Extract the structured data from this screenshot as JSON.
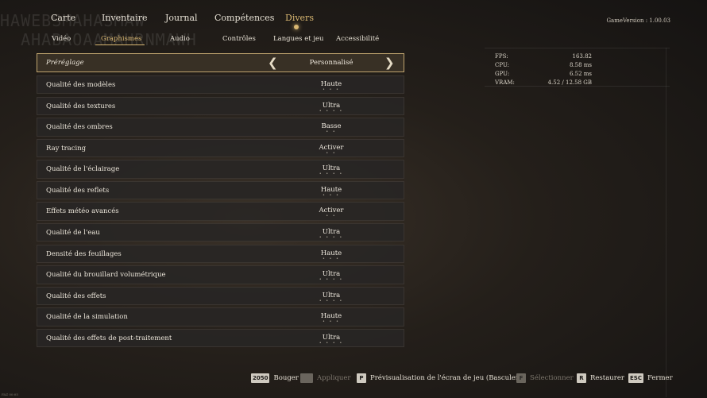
{
  "watermark": "HAWEBSMAHASMAW\n  AHABAOAAMAHRNMAWH",
  "header": {
    "main_tabs": [
      {
        "label": "Carte"
      },
      {
        "label": "Inventaire"
      },
      {
        "label": "Journal"
      },
      {
        "label": "Compétences"
      },
      {
        "label": "Divers"
      }
    ],
    "active_main_tab": "Divers",
    "sub_tabs": [
      {
        "label": "Vidéo"
      },
      {
        "label": "Graphismes"
      },
      {
        "label": "Audio"
      },
      {
        "label": "Contrôles"
      },
      {
        "label": "Langues et jeu"
      },
      {
        "label": "Accessibilité"
      }
    ],
    "active_sub_tab": "Graphismes",
    "game_version": "GameVersion : 1.00.03"
  },
  "preset": {
    "label": "Préréglage",
    "value": "Personnalisé"
  },
  "settings": [
    {
      "label": "Qualité des modèles",
      "value": "Haute",
      "dots": "• • •"
    },
    {
      "label": "Qualité des textures",
      "value": "Ultra",
      "dots": "• • • •"
    },
    {
      "label": "Qualité des ombres",
      "value": "Basse",
      "dots": "• •"
    },
    {
      "label": "Ray tracing",
      "value": "Activer",
      "dots": "• •"
    },
    {
      "label": "Qualité de l'éclairage",
      "value": "Ultra",
      "dots": "• • • •"
    },
    {
      "label": "Qualité des reflets",
      "value": "Haute",
      "dots": "• • •"
    },
    {
      "label": "Effets météo avancés",
      "value": "Activer",
      "dots": "• •"
    },
    {
      "label": "Qualité de l'eau",
      "value": "Ultra",
      "dots": "• • • •"
    },
    {
      "label": "Densité des feuillages",
      "value": "Haute",
      "dots": "• • •"
    },
    {
      "label": "Qualité du brouillard volumétrique",
      "value": "Ultra",
      "dots": "• • • •"
    },
    {
      "label": "Qualité des effets",
      "value": "Ultra",
      "dots": "• • • •"
    },
    {
      "label": "Qualité de la simulation",
      "value": "Haute",
      "dots": "• • •"
    },
    {
      "label": "Qualité des effets de post-traitement",
      "value": "Ultra",
      "dots": "• • • •"
    }
  ],
  "stats": {
    "fps": {
      "label": "FPS:",
      "value": "163.82"
    },
    "cpu": {
      "label": "CPU:",
      "value": "8.58 ms"
    },
    "gpu": {
      "label": "GPU:",
      "value": "6.52 ms"
    },
    "vram": {
      "label": "VRAM:",
      "value": "4.52 / 12.58 GB"
    }
  },
  "footer": {
    "hints": [
      {
        "key": "2050",
        "label": "Bouger",
        "enabled": true
      },
      {
        "key": "",
        "label": "Appliquer",
        "enabled": false
      },
      {
        "key": "P",
        "label": "Prévisualisation de l'écran de jeu (Basculer)",
        "enabled": true
      },
      {
        "key": "F",
        "label": "Sélectionner",
        "enabled": false
      },
      {
        "key": "R",
        "label": "Restaurer",
        "enabled": true
      },
      {
        "key": "ESC",
        "label": "Fermer",
        "enabled": true
      }
    ]
  },
  "corner_text": "FAZ 00:05",
  "colors": {
    "accent": "#d9b772",
    "row_bg": "#282624",
    "preset_border": "#bfa46e"
  }
}
